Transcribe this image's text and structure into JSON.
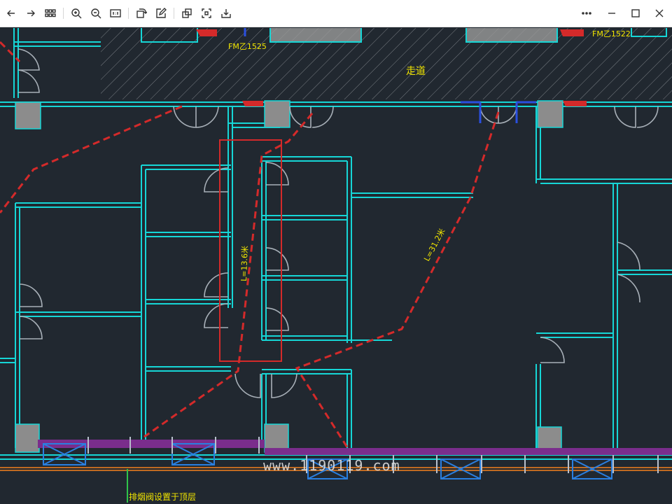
{
  "toolbar": {
    "buttons": [
      {
        "name": "back-button",
        "icon": "arrow-left-icon"
      },
      {
        "name": "forward-button",
        "icon": "arrow-right-icon"
      },
      {
        "name": "grid-view-button",
        "icon": "grid-icon"
      },
      {
        "name": "zoom-in-button",
        "icon": "zoom-in-icon"
      },
      {
        "name": "zoom-out-button",
        "icon": "zoom-out-icon"
      },
      {
        "name": "actual-size-button",
        "icon": "actual-size-icon"
      },
      {
        "name": "rotate-button",
        "icon": "rotate-icon"
      },
      {
        "name": "edit-button",
        "icon": "edit-icon"
      },
      {
        "name": "crop-button",
        "icon": "crop-icon"
      },
      {
        "name": "fullscreen-button",
        "icon": "fullscreen-icon"
      },
      {
        "name": "download-button",
        "icon": "download-icon"
      }
    ],
    "more_icon": "more-icon",
    "window": {
      "minimize": "minimize-icon",
      "maximize": "maximize-icon",
      "close": "close-icon"
    }
  },
  "drawing": {
    "labels": {
      "door_fm1": "FM乙1525",
      "door_fm2": "FM乙1522",
      "corridor": "走道",
      "route1": "L=13.6米",
      "route2": "L=31.2米",
      "bottom_note": "排烟阀设置于顶层"
    },
    "colors": {
      "background": "#212830",
      "walls": "#16d6d6",
      "evac_route": "#d42a2a",
      "text": "#f2e600",
      "highlight_box": "#d42a2a",
      "columns": "#8c8c8c"
    }
  },
  "watermark": "www.1190119.com"
}
